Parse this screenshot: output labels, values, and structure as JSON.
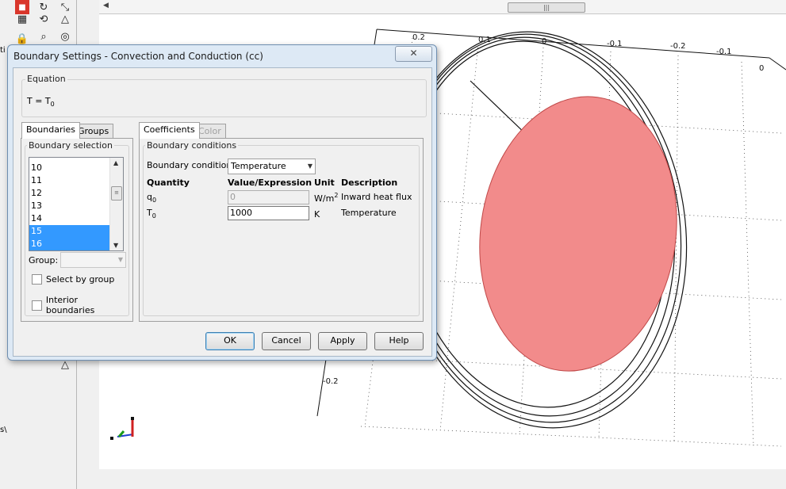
{
  "left_strip": {
    "fragments": [
      "ti",
      "s\\"
    ]
  },
  "dialog": {
    "title": "Boundary Settings - Convection and Conduction (cc)",
    "close_glyph": "✕",
    "equation": {
      "group_label": "Equation",
      "lhs": "T = T",
      "subscript": "0"
    },
    "left_tabs": [
      "Boundaries",
      "Groups"
    ],
    "boundary_selection": {
      "label": "Boundary selection",
      "items": [
        "10",
        "11",
        "12",
        "13",
        "14",
        "15",
        "16"
      ],
      "selected": [
        "15",
        "16"
      ]
    },
    "group_field": {
      "label": "Group:",
      "value": ""
    },
    "checkboxes": {
      "select_by_group": "Select by group",
      "interior_boundaries": "Interior boundaries"
    },
    "right_tabs": [
      "Coefficients",
      "Color"
    ],
    "boundary_conditions": {
      "group_label": "Boundary conditions",
      "condition_label": "Boundary condition:",
      "condition_value": "Temperature",
      "headers": [
        "Quantity",
        "Value/Expression",
        "Unit",
        "Description"
      ],
      "rows": [
        {
          "quantity": "q",
          "quantity_sub": "0",
          "value": "0",
          "unit": "W/m",
          "unit_sup": "2",
          "description": "Inward heat flux"
        },
        {
          "quantity": "T",
          "quantity_sub": "0",
          "value": "1000",
          "unit": "K",
          "unit_sup": "",
          "description": "Temperature"
        }
      ]
    },
    "buttons": {
      "ok": "OK",
      "cancel": "Cancel",
      "apply": "Apply",
      "help": "Help"
    }
  },
  "plot": {
    "top_axis_labels": [
      "0.2",
      "0.1",
      "0",
      "-0.1",
      "-0.2",
      "-0.1",
      "0"
    ],
    "bottom_axis_label": "-0.2",
    "disk_color": "#f28b8b"
  }
}
